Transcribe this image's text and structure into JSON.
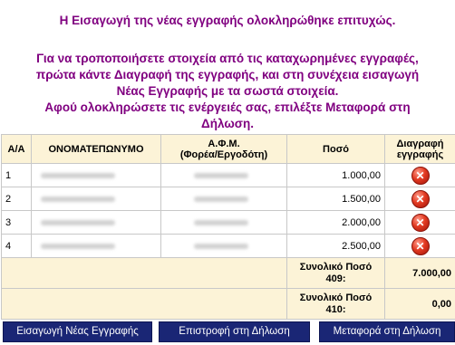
{
  "messages": {
    "success": "Η Εισαγωγή της νέας εγγραφής ολοκληρώθηκε επιτυχώς.",
    "instruction_line1": "Για να τροποποιήσετε στοιχεία από τις καταχωρημένες εγγραφές,",
    "instruction_line2": "πρώτα κάντε Διαγραφή της εγγραφής, και στη συνέχεια εισαγωγή",
    "instruction_line3": "Νέας Εγγραφής με τα σωστά στοιχεία.",
    "instruction_line4": "Αφού ολοκληρώσετε τις ενέργειές σας, επιλέξτε Μεταφορά στη",
    "instruction_line5": "Δήλωση."
  },
  "table": {
    "headers": {
      "aa": "Α/Α",
      "name": "ΟΝΟΜΑΤΕΠΩΝΥΜΟ",
      "afm_line1": "Α.Φ.Μ.",
      "afm_line2": "(Φορέα/Εργοδότη)",
      "amount": "Ποσό",
      "delete_line1": "Διαγραφή",
      "delete_line2": "εγγραφής"
    },
    "rows": [
      {
        "aa": "1",
        "amount": "1.000,00",
        "delete_icon": "delete-icon"
      },
      {
        "aa": "2",
        "amount": "1.500,00",
        "delete_icon": "delete-icon"
      },
      {
        "aa": "3",
        "amount": "2.000,00",
        "delete_icon": "delete-icon"
      },
      {
        "aa": "4",
        "amount": "2.500,00",
        "delete_icon": "delete-icon"
      }
    ],
    "totals": [
      {
        "label_line1": "Συνολικό Ποσό",
        "label_line2": "409:",
        "value": "7.000,00"
      },
      {
        "label_line1": "Συνολικό Ποσό",
        "label_line2": "410:",
        "value": "0,00"
      }
    ]
  },
  "buttons": {
    "new_entry": "Εισαγωγή Νέας Εγγραφής",
    "back": "Επιστροφή στη Δήλωση",
    "transfer": "Μεταφορά στη Δήλωση"
  },
  "colors": {
    "message": "#800080",
    "header_bg": "#fcf3d7",
    "button_bg": "#1a2675",
    "delete_icon": "#e23a22"
  }
}
